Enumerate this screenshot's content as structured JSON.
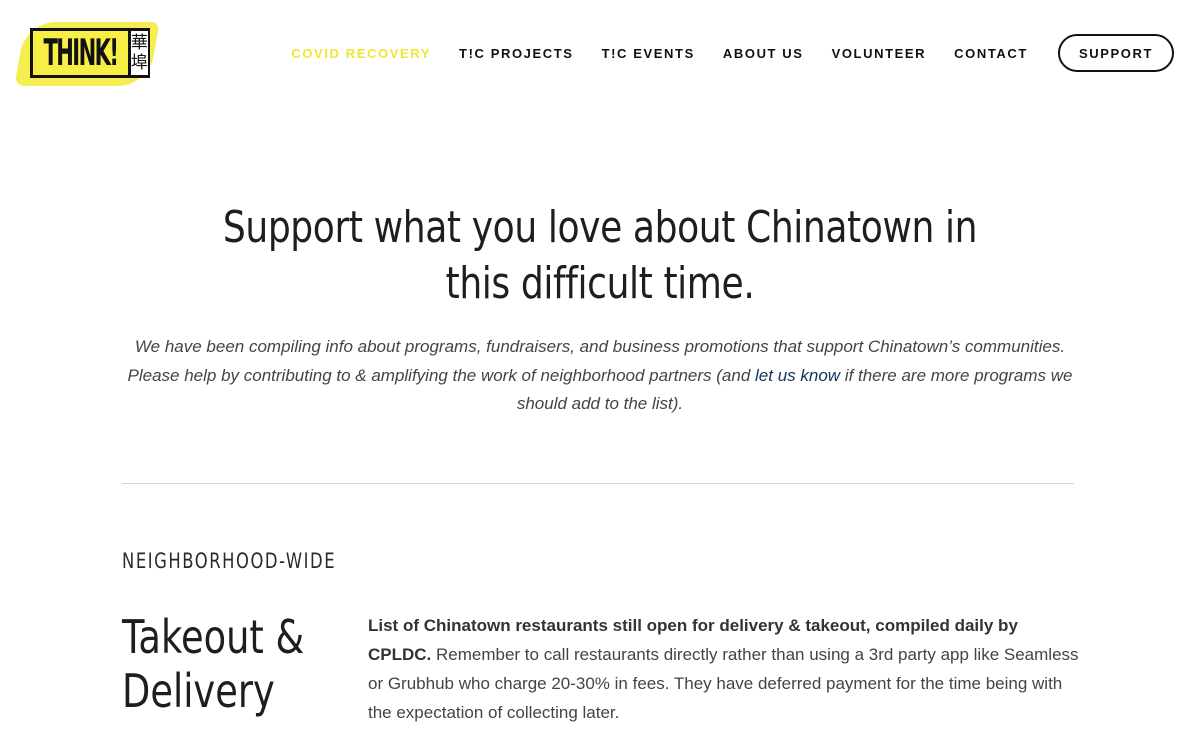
{
  "header": {
    "logo_text": "THINK!",
    "logo_cjk_top": "華",
    "logo_cjk_bottom": "埠",
    "nav": [
      {
        "label": "COVID RECOVERY",
        "active": true
      },
      {
        "label": "T!C PROJECTS"
      },
      {
        "label": "T!C EVENTS"
      },
      {
        "label": "ABOUT US"
      },
      {
        "label": "VOLUNTEER"
      },
      {
        "label": "CONTACT"
      }
    ],
    "support_label": "SUPPORT"
  },
  "hero": {
    "title": "Support what you love about Chinatown in this difficult time.",
    "desc_before": "We have been compiling info about programs, fundraisers, and business promotions that support Chinatown’s communities. Please help by contributing to & amplifying the work of neighborhood partners (and ",
    "desc_link": "let us know",
    "desc_after": " if there are more programs we should add to the list)."
  },
  "section": {
    "label": "NEIGHBORHOOD-WIDE",
    "item": {
      "title": "Takeout & Delivery",
      "lead": "List of Chinatown restaurants still open for delivery & takeout, compiled daily by CPLDC.",
      "body": " Remember to call restaurants directly rather than using a 3rd party app like Seamless or Grubhub who charge 20-30% in fees. They have deferred payment for the time being with the expectation of collecting later."
    }
  },
  "colors": {
    "accent_yellow": "#f0e532",
    "text_dark": "#1e1e1e",
    "link_navy": "#14325c"
  }
}
